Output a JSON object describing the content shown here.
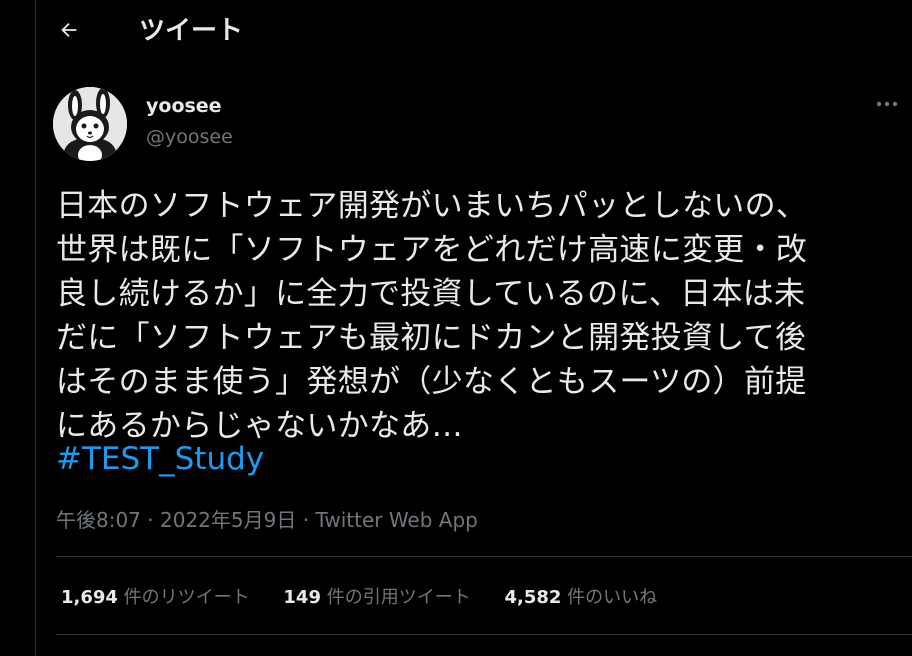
{
  "header": {
    "back_icon": "arrow-left-icon",
    "title": "ツイート"
  },
  "author": {
    "name": "yoosee",
    "handle": "@yoosee",
    "avatar_icon": "rabbit-avatar"
  },
  "tweet": {
    "lines": [
      "日本のソフトウェア開発がいまいちパッとしないの、",
      "世界は既に「ソフトウェアをどれだけ高速に変更・改",
      "良し続けるか」に全力で投資しているのに、日本は未",
      "だに「ソフトウェアも最初にドカンと開発投資して後",
      "はそのまま使う」発想が（少なくともスーツの）前提",
      "にあるからじゃないかなあ…"
    ],
    "hashtag": "#TEST_Study",
    "time": "午後8:07",
    "date": "2022年5月9日",
    "source": "Twitter Web App",
    "separator": "·"
  },
  "stats": {
    "retweets": {
      "count": "1,694",
      "label": "件のリツイート"
    },
    "quotes": {
      "count": "149",
      "label": "件の引用ツイート"
    },
    "likes": {
      "count": "4,582",
      "label": "件のいいね"
    }
  },
  "colors": {
    "background": "#000000",
    "text": "#e7e9ea",
    "muted": "#71767b",
    "accent": "#1d9bf0",
    "border": "#2f3336"
  }
}
